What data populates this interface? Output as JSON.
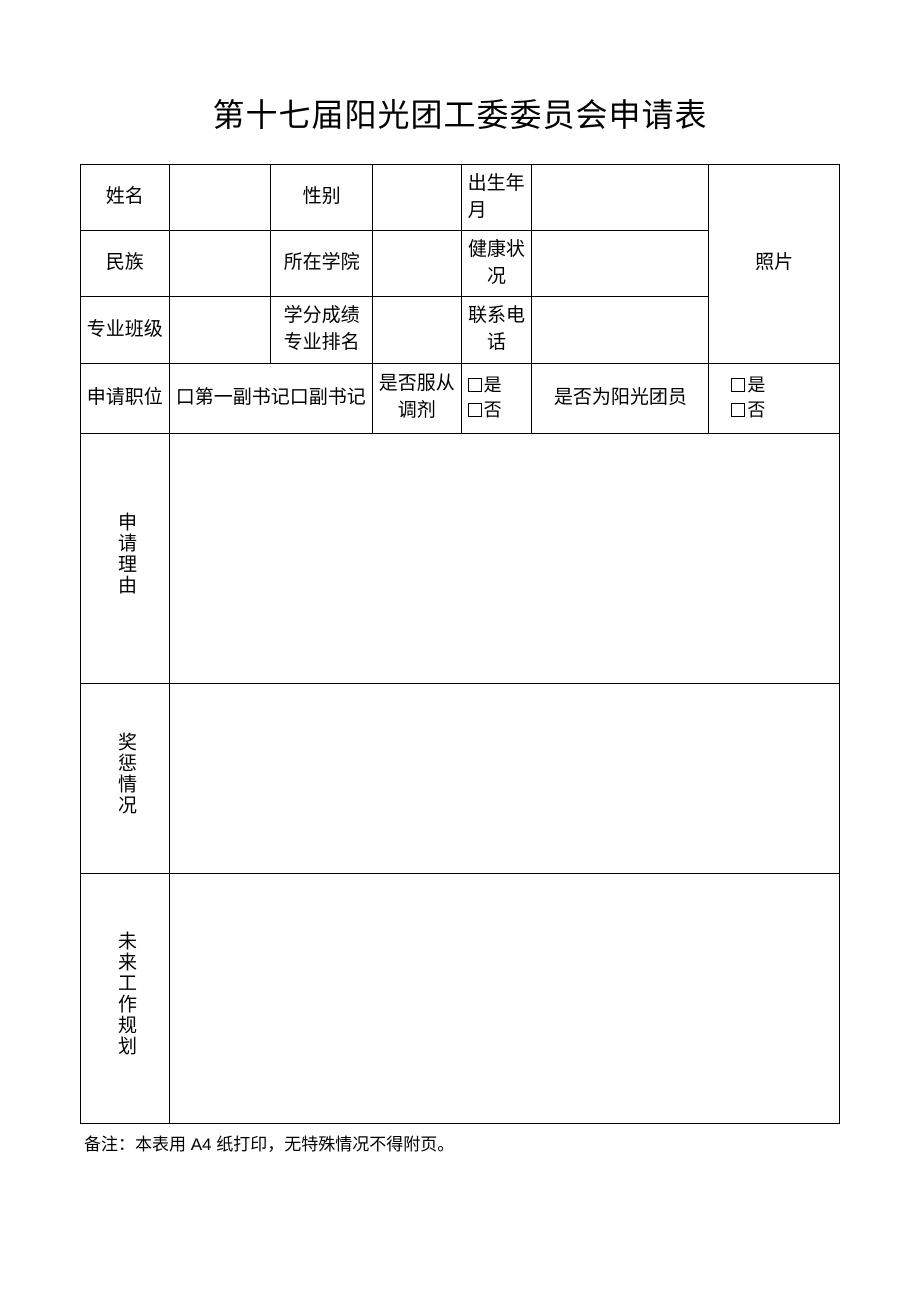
{
  "title": "第十七届阳光团工委委员会申请表",
  "labels": {
    "name": "姓名",
    "gender": "性别",
    "birth": "出生年月",
    "ethnicity": "民族",
    "college": "所在学院",
    "health": "健康状况",
    "major_class": "专业班级",
    "score_rank": "学分成绩专业排名",
    "phone": "联系电话",
    "photo": "照片",
    "apply_position": "申请职位",
    "position_options": "口第一副书记口副书记",
    "accept_transfer": "是否服从调剂",
    "yes": "是",
    "no": "否",
    "is_member": "是否为阳光团员",
    "reason": "申请理由",
    "awards": "奖惩情况",
    "plan": "未来工作规划"
  },
  "footnote_prefix": "备注：本表用",
  "footnote_a4": " A4 ",
  "footnote_suffix": "纸打印，无特殊情况不得附页。"
}
